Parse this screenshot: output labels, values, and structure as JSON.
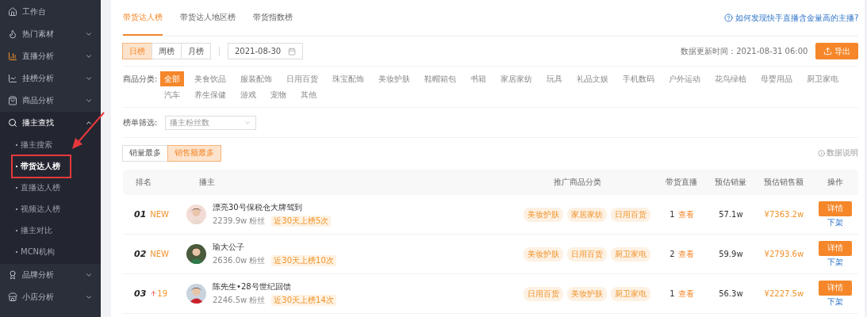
{
  "sidebar": {
    "items": [
      {
        "label": "工作台"
      },
      {
        "label": "热门素材",
        "expanded": false
      },
      {
        "label": "直播分析",
        "expanded": false
      },
      {
        "label": "挂榜分析",
        "expanded": false
      },
      {
        "label": "商品分析",
        "expanded": false
      },
      {
        "label": "播主查找",
        "expanded": true,
        "children": [
          {
            "label": "播主搜索",
            "selected": false,
            "highlighted": false
          },
          {
            "label": "带货达人榜",
            "selected": true,
            "highlighted": true
          },
          {
            "label": "直播达人榜",
            "selected": false,
            "highlighted": false
          },
          {
            "label": "视频达人榜",
            "selected": false,
            "highlighted": false
          },
          {
            "label": "播主对比",
            "selected": false,
            "highlighted": false
          },
          {
            "label": "MCN机构",
            "selected": false,
            "highlighted": false
          }
        ]
      },
      {
        "label": "品牌分析",
        "expanded": false
      },
      {
        "label": "小店分析",
        "expanded": false
      }
    ]
  },
  "annotation": {
    "kind": "arrow"
  },
  "tabs": [
    {
      "label": "带货达人榜",
      "selected": true
    },
    {
      "label": "带货达人地区榜",
      "selected": false
    },
    {
      "label": "带货指数榜",
      "selected": false
    }
  ],
  "help_link": "如何发现快手直播含金量高的主播?",
  "periods": [
    {
      "label": "日榜",
      "selected": true
    },
    {
      "label": "周榜",
      "selected": false
    },
    {
      "label": "月榜",
      "selected": false
    }
  ],
  "date": {
    "value": "2021-08-30"
  },
  "update_time": "数据更新时间：2021-08-31 06:00",
  "export_button": "导出",
  "category_filter": {
    "label": "商品分类:",
    "options": [
      {
        "label": "全部",
        "selected": true
      },
      {
        "label": "美食饮品",
        "selected": false
      },
      {
        "label": "服装配饰",
        "selected": false
      },
      {
        "label": "日用百货",
        "selected": false
      },
      {
        "label": "珠宝配饰",
        "selected": false
      },
      {
        "label": "美妆护肤",
        "selected": false
      },
      {
        "label": "鞋帽箱包",
        "selected": false
      },
      {
        "label": "书籍",
        "selected": false
      },
      {
        "label": "家居家纺",
        "selected": false
      },
      {
        "label": "玩具",
        "selected": false
      },
      {
        "label": "礼品文娱",
        "selected": false
      },
      {
        "label": "手机数码",
        "selected": false
      },
      {
        "label": "户外运动",
        "selected": false
      },
      {
        "label": "花鸟绿植",
        "selected": false
      },
      {
        "label": "母婴用品",
        "selected": false
      },
      {
        "label": "厨卫家电",
        "selected": false
      },
      {
        "label": "汽车",
        "selected": false
      },
      {
        "label": "养生保健",
        "selected": false
      },
      {
        "label": "游戏",
        "selected": false
      },
      {
        "label": "宠物",
        "selected": false
      },
      {
        "label": "其他",
        "selected": false
      }
    ]
  },
  "list_filter": {
    "label": "榜单筛选:",
    "value": "播主粉丝数"
  },
  "sort_options": [
    {
      "label": "销量最多",
      "selected": false
    },
    {
      "label": "销售额最多",
      "selected": true
    }
  ],
  "data_note": "数据说明",
  "table": {
    "columns": [
      "排名",
      "播主",
      "推广商品分类",
      "带货直播",
      "预估销量",
      "预估销售额",
      "操作"
    ],
    "rows": [
      {
        "rank": "01",
        "trend": {
          "kind": "new",
          "text": "NEW"
        },
        "name": "漂亮30号保税仓大牌驾到",
        "fans": "2239.9w 粉丝",
        "badge": "近30天上榜5次",
        "categories": [
          "美妆护肤",
          "家居家纺",
          "日用百货"
        ],
        "live_count": "1",
        "live_link": "查看",
        "sales": "57.1w",
        "amount": "¥7363.2w",
        "detail_button": "详情",
        "remove_link": "下架"
      },
      {
        "rank": "02",
        "trend": {
          "kind": "new",
          "text": "NEW"
        },
        "name": "瑜大公子",
        "fans": "2636.0w 粉丝",
        "badge": "近30天上榜10次",
        "categories": [
          "美妆护肤",
          "日用百货",
          "厨卫家电"
        ],
        "live_count": "2",
        "live_link": "查看",
        "sales": "59.9w",
        "amount": "¥2793.6w",
        "detail_button": "详情",
        "remove_link": "下架"
      },
      {
        "rank": "03",
        "trend": {
          "kind": "up",
          "text": "19"
        },
        "name": "陈先生•28号世纪回馈",
        "fans": "2246.5w 粉丝",
        "badge": "近30天上榜14次",
        "categories": [
          "日用百货",
          "美妆护肤",
          "厨卫家电"
        ],
        "live_count": "1",
        "live_link": "查看",
        "sales": "56.3w",
        "amount": "¥2227.5w",
        "detail_button": "详情",
        "remove_link": "下架"
      }
    ]
  }
}
